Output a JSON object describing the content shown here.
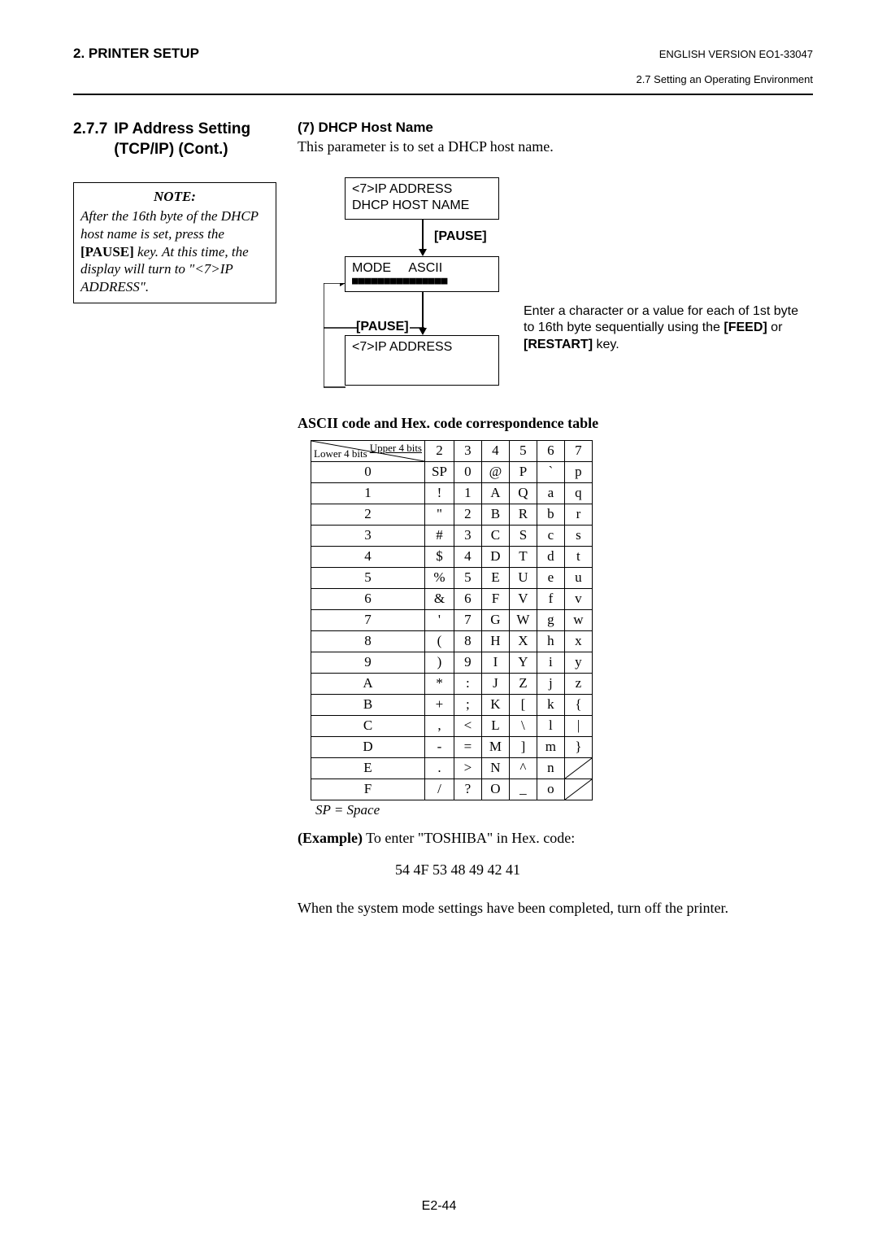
{
  "header": {
    "chapter": "2. PRINTER SETUP",
    "version": "ENGLISH VERSION EO1-33047",
    "section_path": "2.7 Setting an Operating Environment"
  },
  "section": {
    "number": "2.7.7",
    "title": "IP Address Setting (TCP/IP) (Cont.)"
  },
  "note": {
    "title": "NOTE:",
    "body_pre": "After the 16th byte of the DHCP host name is set, press the ",
    "body_key": "[PAUSE]",
    "body_post": " key.  At this time, the display will turn to \"<7>IP ADDRESS\"."
  },
  "item7": {
    "label": "(7)  DHCP Host Name",
    "desc": "This parameter is to set a DHCP host name."
  },
  "diagram": {
    "box1_line1": "<7>IP ADDRESS",
    "box1_line2": "DHCP HOST NAME",
    "pause": "[PAUSE]",
    "mode_line": "MODE     ASCII",
    "blocks": "■■■■■■■■■■■■■■■",
    "side": {
      "pre": "Enter a character or a value for each of 1st byte to 16th byte sequentially using the ",
      "k1": "[FEED]",
      "mid": " or ",
      "k2": "[RESTART]",
      "post": " key."
    },
    "box3": "<7>IP ADDRESS"
  },
  "table": {
    "title": "ASCII code and Hex. code correspondence table",
    "corner_upper": "Upper 4 bits",
    "corner_lower": "Lower 4 bits",
    "cols": [
      "2",
      "3",
      "4",
      "5",
      "6",
      "7"
    ],
    "rows": [
      {
        "h": "0",
        "c": [
          "SP",
          "0",
          "@",
          "P",
          "`",
          "p"
        ]
      },
      {
        "h": "1",
        "c": [
          "!",
          "1",
          "A",
          "Q",
          "a",
          "q"
        ]
      },
      {
        "h": "2",
        "c": [
          "\"",
          "2",
          "B",
          "R",
          "b",
          "r"
        ]
      },
      {
        "h": "3",
        "c": [
          "#",
          "3",
          "C",
          "S",
          "c",
          "s"
        ]
      },
      {
        "h": "4",
        "c": [
          "$",
          "4",
          "D",
          "T",
          "d",
          "t"
        ]
      },
      {
        "h": "5",
        "c": [
          "%",
          "5",
          "E",
          "U",
          "e",
          "u"
        ]
      },
      {
        "h": "6",
        "c": [
          "&",
          "6",
          "F",
          "V",
          "f",
          "v"
        ]
      },
      {
        "h": "7",
        "c": [
          "'",
          "7",
          "G",
          "W",
          "g",
          "w"
        ]
      },
      {
        "h": "8",
        "c": [
          "(",
          "8",
          "H",
          "X",
          "h",
          "x"
        ]
      },
      {
        "h": "9",
        "c": [
          ")",
          "9",
          "I",
          "Y",
          "i",
          "y"
        ]
      },
      {
        "h": "A",
        "c": [
          "*",
          ":",
          "J",
          "Z",
          "j",
          "z"
        ]
      },
      {
        "h": "B",
        "c": [
          "+",
          ";",
          "K",
          "[",
          "k",
          "{"
        ]
      },
      {
        "h": "C",
        "c": [
          ",",
          "<",
          "L",
          "\\",
          "l",
          "|"
        ]
      },
      {
        "h": "D",
        "c": [
          "-",
          "=",
          "M",
          "]",
          "m",
          "}"
        ]
      },
      {
        "h": "E",
        "c": [
          ".",
          ">",
          "N",
          "^",
          "n",
          ""
        ]
      },
      {
        "h": "F",
        "c": [
          "/",
          "?",
          "O",
          "_",
          "o",
          ""
        ]
      }
    ],
    "sp_note": "SP = Space"
  },
  "example": {
    "label": "(Example)",
    "text": " To enter \"TOSHIBA\" in Hex. code:",
    "hex": "54 4F 53 48 49 42 41"
  },
  "final": "When the system mode settings have been completed, turn off the printer.",
  "pagenum": "E2-44"
}
